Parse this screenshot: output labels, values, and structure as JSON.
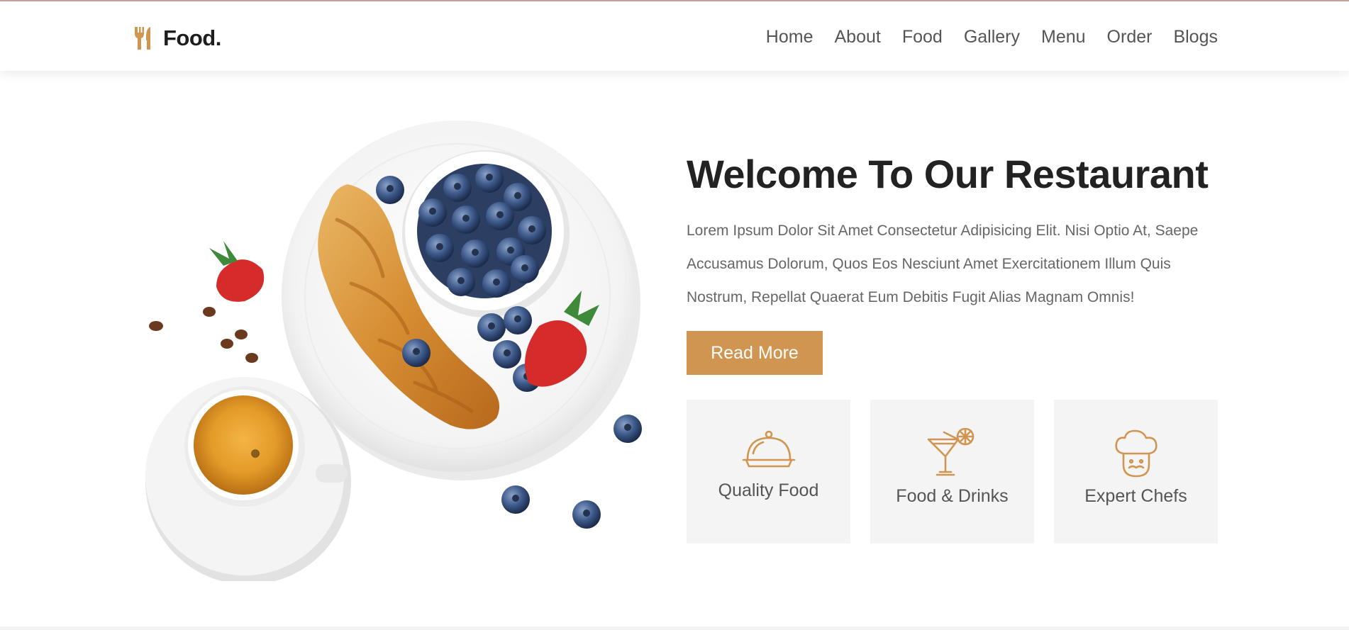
{
  "brand": {
    "name": "Food.",
    "accent": "#d09651"
  },
  "nav": {
    "items": [
      {
        "label": "Home"
      },
      {
        "label": "About"
      },
      {
        "label": "Food"
      },
      {
        "label": "Gallery"
      },
      {
        "label": "Menu"
      },
      {
        "label": "Order"
      },
      {
        "label": "Blogs"
      }
    ]
  },
  "hero": {
    "title": "Welcome To Our Restaurant",
    "description": "Lorem Ipsum Dolor Sit Amet Consectetur Adipisicing Elit. Nisi Optio At, Saepe Accusamus Dolorum, Quos Eos Nesciunt Amet Exercitationem Illum Quis Nostrum, Repellat Quaerat Eum Debitis Fugit Alias Magnam Omnis!",
    "button_label": "Read More",
    "image_icon": "breakfast-plate-image"
  },
  "features": [
    {
      "label": "Quality Food",
      "icon": "cloche-icon"
    },
    {
      "label": "Food & Drinks",
      "icon": "cocktail-icon"
    },
    {
      "label": "Expert Chefs",
      "icon": "chef-icon"
    }
  ]
}
